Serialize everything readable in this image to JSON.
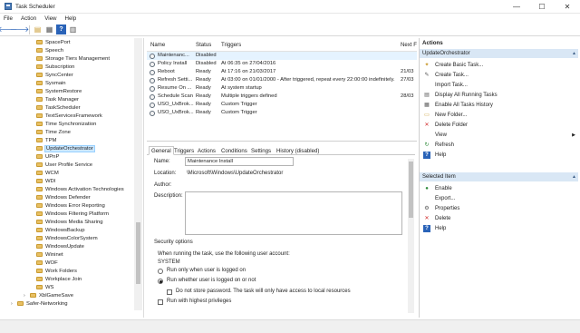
{
  "window": {
    "title": "Task Scheduler",
    "min": "—",
    "max": "☐",
    "close": "✕"
  },
  "menu": [
    "File",
    "Action",
    "View",
    "Help"
  ],
  "toolbar": {
    "back": "🡐",
    "forward": "🡒",
    "folder": "▤",
    "props": "▦",
    "help": "?",
    "view": "▥"
  },
  "tree": {
    "items": [
      {
        "label": "SpacePort"
      },
      {
        "label": "Speech"
      },
      {
        "label": "Storage Tiers Management"
      },
      {
        "label": "Subscription"
      },
      {
        "label": "SyncCenter"
      },
      {
        "label": "Sysmain"
      },
      {
        "label": "SystemRestore"
      },
      {
        "label": "Task Manager"
      },
      {
        "label": "TaskScheduler"
      },
      {
        "label": "TextServicesFramework"
      },
      {
        "label": "Time Synchronization"
      },
      {
        "label": "Time Zone"
      },
      {
        "label": "TPM"
      },
      {
        "label": "UpdateOrchestrator"
      },
      {
        "label": "UPnP"
      },
      {
        "label": "User Profile Service"
      },
      {
        "label": "WCM"
      },
      {
        "label": "WDI"
      },
      {
        "label": "Windows Activation Technologies"
      },
      {
        "label": "Windows Defender"
      },
      {
        "label": "Windows Error Reporting"
      },
      {
        "label": "Windows Filtering Platform"
      },
      {
        "label": "Windows Media Sharing"
      },
      {
        "label": "WindowsBackup"
      },
      {
        "label": "WindowsColorSystem"
      },
      {
        "label": "WindowsUpdate"
      },
      {
        "label": "Wininet"
      },
      {
        "label": "WOF"
      },
      {
        "label": "Work Folders"
      },
      {
        "label": "Workplace Join"
      },
      {
        "label": "WS"
      }
    ],
    "xbl": "XblGameSave",
    "safer": "Safer-Networking",
    "expand_arrow": "›"
  },
  "tasklist": {
    "headers": {
      "name": "Name",
      "status": "Status",
      "triggers": "Triggers",
      "next": "Next F"
    },
    "rows": [
      {
        "name": "Maintenanc...",
        "status": "Disabled",
        "triggers": "",
        "next": ""
      },
      {
        "name": "Policy Install",
        "status": "Disabled",
        "triggers": "At 06:35 on 27/04/2016",
        "next": ""
      },
      {
        "name": "Reboot",
        "status": "Ready",
        "triggers": "At 17:16 on 21/03/2017",
        "next": "21/03"
      },
      {
        "name": "Refresh Setti...",
        "status": "Ready",
        "triggers": "At 03:00 on 01/01/2000 - After triggered, repeat every 22:00:00 indefinitely.",
        "next": "27/03"
      },
      {
        "name": "Resume On ...",
        "status": "Ready",
        "triggers": "At system startup",
        "next": ""
      },
      {
        "name": "Schedule Scan",
        "status": "Ready",
        "triggers": "Multiple triggers defined",
        "next": "28/03"
      },
      {
        "name": "USO_UxBrok...",
        "status": "Ready",
        "triggers": "Custom Trigger",
        "next": ""
      },
      {
        "name": "USO_UxBrok...",
        "status": "Ready",
        "triggers": "Custom Trigger",
        "next": ""
      }
    ]
  },
  "tabs": [
    "General",
    "Triggers",
    "Actions",
    "Conditions",
    "Settings",
    "History (disabled)"
  ],
  "details": {
    "name_label": "Name:",
    "name_value": "Maintenance Install",
    "location_label": "Location:",
    "location_value": "\\Microsoft\\Windows\\UpdateOrchestrator",
    "author_label": "Author:",
    "description_label": "Description:",
    "security_label": "Security options",
    "security_text": "When running the task, use the following user account:",
    "account": "SYSTEM",
    "opt1": "Run only when user is logged on",
    "opt2": "Run whether user is logged on or not",
    "opt3": "Do not store password.  The task will only have access to local resources",
    "opt4": "Run with highest privileges"
  },
  "actions": {
    "header": "Actions",
    "section1": "UpdateOrchestrator",
    "items1": [
      {
        "label": "Create Basic Task...",
        "icon": "✦"
      },
      {
        "label": "Create Task...",
        "icon": "✎"
      },
      {
        "label": "Import Task...",
        "icon": ""
      },
      {
        "label": "Display All Running Tasks",
        "icon": "▤"
      },
      {
        "label": "Enable All Tasks History",
        "icon": "▦"
      },
      {
        "label": "New Folder...",
        "icon": "▭"
      },
      {
        "label": "Delete Folder",
        "icon": "✕"
      },
      {
        "label": "View",
        "icon": "",
        "more": "▶"
      },
      {
        "label": "Refresh",
        "icon": "↻"
      },
      {
        "label": "Help",
        "icon": "?"
      }
    ],
    "section2": "Selected Item",
    "items2": [
      {
        "label": "Enable",
        "icon": "●"
      },
      {
        "label": "Export...",
        "icon": ""
      },
      {
        "label": "Properties",
        "icon": "⚙"
      },
      {
        "label": "Delete",
        "icon": "✕"
      },
      {
        "label": "Help",
        "icon": "?"
      }
    ],
    "caret": "▲"
  },
  "colors": {
    "selection": "#cde8ff",
    "actions_sub": "#d9e7f5",
    "delete_red": "#d12b2b",
    "refresh_green": "#2e8b3a",
    "help_blue": "#2a63b8"
  }
}
